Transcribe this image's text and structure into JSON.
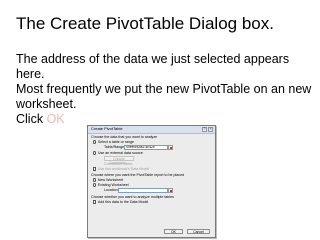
{
  "slide": {
    "title": "The Create PivotTable Dialog box.",
    "line1": "The address of the data we just selected appears here.",
    "line2": "Most frequently we put the new PivotTable on an new worksheet.",
    "line3_prefix": "Click ",
    "line3_ok": "OK",
    "ok_color": "#f4b8b8"
  },
  "dialog": {
    "title": "Create PivotTable",
    "help_glyph": "?",
    "close_glyph": "×",
    "section_analyze": "Choose the data that you want to analyze",
    "option_select_table": "Select a table or range",
    "table_range_label": "Table/Range:",
    "table_range_value": "Sheet5!$A$1:$E$28",
    "option_external": "Use an external data source",
    "choose_connection": "Choose Connection...",
    "connection_name": "Connection name:",
    "use_data_model": "Use this workbook's Data Model",
    "section_placement": "Choose where you want the PivotTable report to be placed",
    "option_new_worksheet": "New Worksheet",
    "option_existing_worksheet": "Existing Worksheet",
    "location_label": "Location:",
    "location_value": "",
    "section_multiple": "Choose whether you want to analyze multiple tables",
    "add_to_data_model": "Add this data to the Data Model",
    "ok_label": "OK",
    "cancel_label": "Cancel"
  }
}
